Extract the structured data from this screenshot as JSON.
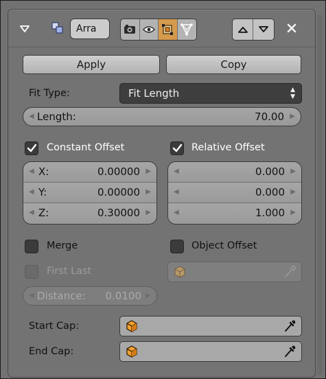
{
  "header": {
    "name_value": "Arra",
    "icons": [
      "collapse-arrow-icon",
      "array-modifier-icon",
      "camera-render-icon",
      "eye-viewport-icon",
      "editmode-icon",
      "cage-icon",
      "move-up-icon",
      "move-down-icon",
      "close-icon"
    ]
  },
  "actions": {
    "apply": "Apply",
    "copy": "Copy"
  },
  "fit_type": {
    "label": "Fit Type:",
    "value": "Fit Length"
  },
  "length": {
    "label": "Length:",
    "value": "70.00"
  },
  "constant_offset": {
    "label": "Constant Offset",
    "checked": true,
    "x": {
      "label": "X:",
      "value": "0.00000"
    },
    "y": {
      "label": "Y:",
      "value": "0.00000"
    },
    "z": {
      "label": "Z:",
      "value": "0.30000"
    }
  },
  "relative_offset": {
    "label": "Relative Offset",
    "checked": true,
    "x": "0.000",
    "y": "0.000",
    "z": "1.000"
  },
  "merge": {
    "label": "Merge",
    "checked": false
  },
  "object_offset": {
    "label": "Object Offset",
    "checked": false
  },
  "first_last": {
    "label": "First Last",
    "checked": false
  },
  "distance": {
    "label": "Distance:",
    "value": "0.0100"
  },
  "start_cap": {
    "label": "Start Cap:"
  },
  "end_cap": {
    "label": "End Cap:"
  },
  "colors": {
    "panel": "#737373",
    "active_toggle": "#d59a4d",
    "field": "#a5a5a5",
    "dropdown": "#3e3e3e"
  }
}
